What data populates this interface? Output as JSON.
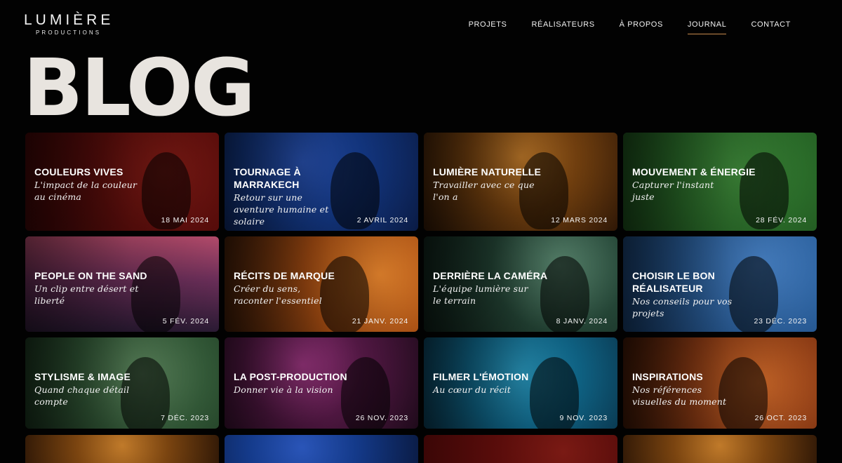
{
  "brand": {
    "name": "LUMIÈRE",
    "tagline": "PRODUCTIONS"
  },
  "nav": [
    {
      "label": "PROJETS",
      "active": false
    },
    {
      "label": "RÉALISATEURS",
      "active": false
    },
    {
      "label": "À PROPOS",
      "active": false
    },
    {
      "label": "JOURNAL",
      "active": true
    },
    {
      "label": "CONTACT",
      "active": false
    }
  ],
  "page_title": "BLOG",
  "accent_color": "#c98a4d",
  "posts": [
    {
      "title": "COULEURS VIVES",
      "subtitle": "L'impact de la couleur au cinéma",
      "date": "18 MAI 2024",
      "tone": "crimson"
    },
    {
      "title": "TOURNAGE À MARRAKECH",
      "subtitle": "Retour sur une aventure humaine et solaire",
      "date": "2 AVRIL 2024",
      "tone": "blue"
    },
    {
      "title": "LUMIÈRE NATURELLE",
      "subtitle": "Travailler avec ce que l'on a",
      "date": "12 MARS 2024",
      "tone": "amber"
    },
    {
      "title": "MOUVEMENT & ÉNERGIE",
      "subtitle": "Capturer l'instant juste",
      "date": "28 FÉV. 2024",
      "tone": "green"
    },
    {
      "title": "PEOPLE ON THE SAND",
      "subtitle": "Un clip entre désert et liberté",
      "date": "5 FÉV. 2024",
      "tone": "dusk"
    },
    {
      "title": "RÉCITS DE MARQUE",
      "subtitle": "Créer du sens, raconter l'essentiel",
      "date": "21 JANV. 2024",
      "tone": "orange"
    },
    {
      "title": "DERRIÈRE LA CAMÉRA",
      "subtitle": "L'équipe lumière sur le terrain",
      "date": "8 JANV. 2024",
      "tone": "teal"
    },
    {
      "title": "CHOISIR LE BON RÉALISATEUR",
      "subtitle": "Nos conseils pour vos projets",
      "date": "23 DÉC. 2023",
      "tone": "sky"
    },
    {
      "title": "STYLISME & IMAGE",
      "subtitle": "Quand chaque détail compte",
      "date": "7 DÉC. 2023",
      "tone": "sage"
    },
    {
      "title": "LA POST-PRODUCTION",
      "subtitle": "Donner vie à la vision",
      "date": "26 NOV. 2023",
      "tone": "violet"
    },
    {
      "title": "FILMER L'ÉMOTION",
      "subtitle": "Au cœur du récit",
      "date": "9 NOV. 2023",
      "tone": "aqua"
    },
    {
      "title": "INSPIRATIONS",
      "subtitle": "Nos références visuelles du moment",
      "date": "26 OCT. 2023",
      "tone": "rust"
    }
  ],
  "next_row_tones": [
    "amber",
    "blue",
    "crimson",
    "amber"
  ]
}
